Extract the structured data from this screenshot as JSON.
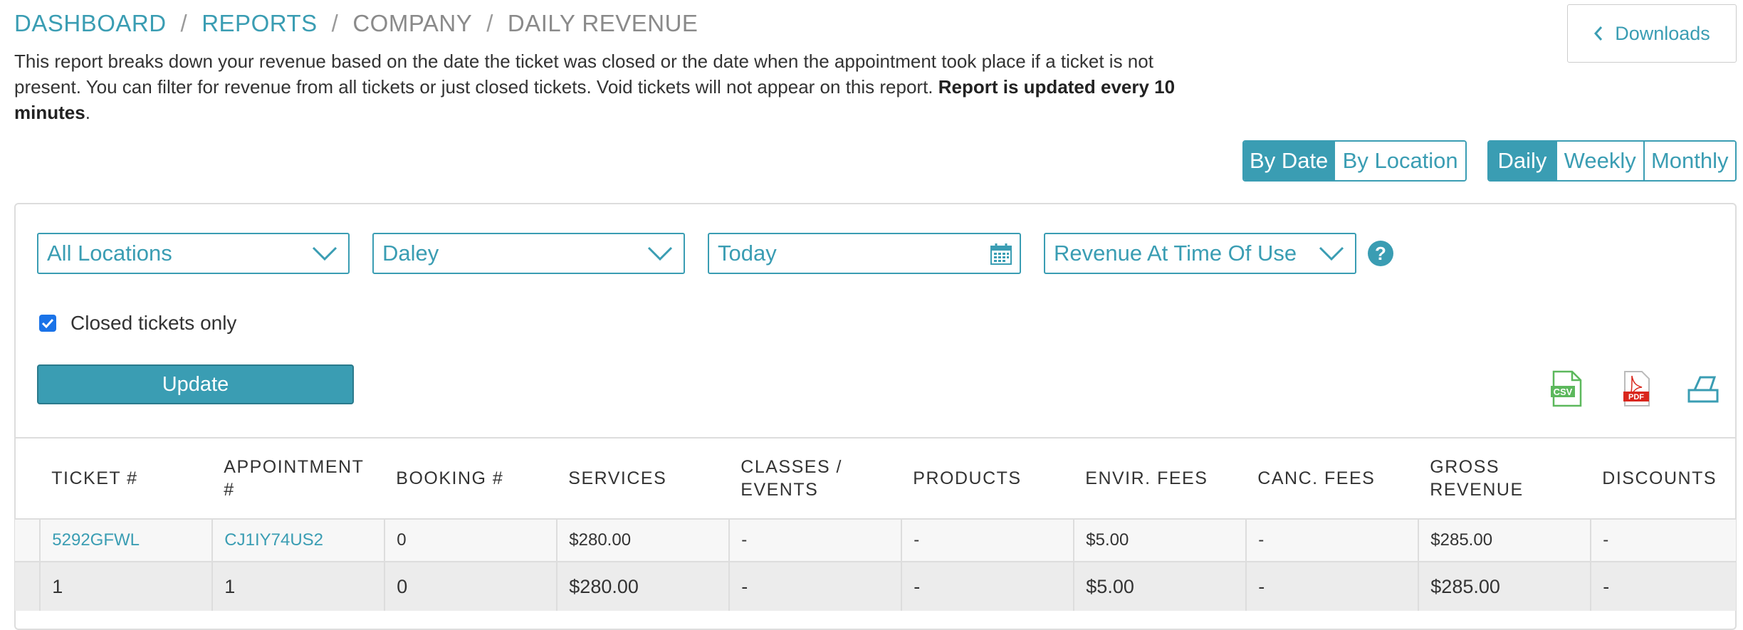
{
  "breadcrumb": {
    "items": [
      "DASHBOARD",
      "REPORTS",
      "COMPANY",
      "DAILY REVENUE"
    ],
    "separator": "/"
  },
  "description": {
    "text": "This report breaks down your revenue based on the date the ticket was closed or the date when the appointment took place if a ticket is not present. You can filter for revenue from all tickets or just closed tickets. Void tickets will not appear on this report.",
    "emphasis": "Report is updated every 10 minutes",
    "suffix": "."
  },
  "downloads": {
    "label": "Downloads",
    "icon": "chevron-left-icon"
  },
  "view_toggle": {
    "options": [
      "By Date",
      "By Location"
    ],
    "selected": "By Date"
  },
  "period_toggle": {
    "options": [
      "Daily",
      "Weekly",
      "Monthly"
    ],
    "selected": "Daily"
  },
  "filters": {
    "location": "All Locations",
    "staff": "Daley",
    "date": "Today",
    "revenue_mode": "Revenue At Time Of Use",
    "help": "?"
  },
  "closed_only": {
    "label": "Closed tickets only",
    "checked": true
  },
  "update_label": "Update",
  "exports": {
    "csv": "CSV",
    "pdf": "PDF",
    "print": "print-icon"
  },
  "table": {
    "headers": [
      "TICKET #",
      "APPOINTMENT #",
      "BOOKING #",
      "SERVICES",
      "CLASSES / EVENTS",
      "PRODUCTS",
      "ENVIR. FEES",
      "CANC. FEES",
      "GROSS REVENUE",
      "DISCOUNTS"
    ],
    "rows": [
      [
        "5292GFWL",
        "CJ1IY74US2",
        "0",
        "$280.00",
        "-",
        "-",
        "$5.00",
        "-",
        "$285.00",
        "-"
      ],
      [
        "1",
        "1",
        "0",
        "$280.00",
        "-",
        "-",
        "$5.00",
        "-",
        "$285.00",
        "-"
      ]
    ]
  },
  "colors": {
    "accent": "#3a9db3",
    "checkbox": "#1a73e8",
    "csv": "#5cb85c",
    "pdf": "#d9261c"
  }
}
